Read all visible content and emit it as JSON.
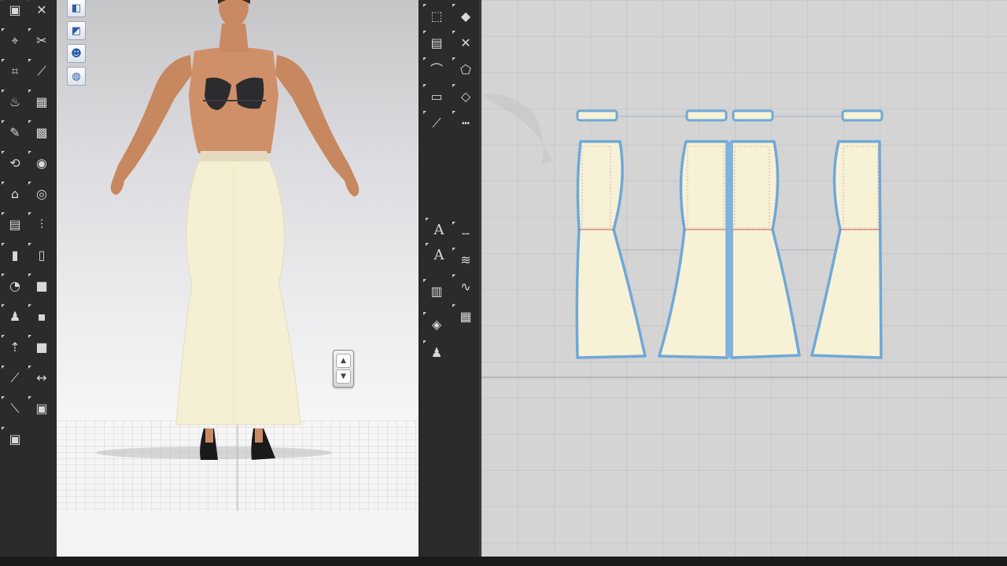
{
  "app": {
    "colors": {
      "toolbar_bg": "#2b2b2b",
      "fabric": "#f7f1d6",
      "pattern_outline": "#6fa8d6",
      "viewport_3d_bg": "#e6e6e9",
      "viewport_2d_bg": "#d4d4d4"
    }
  },
  "toolbar_left": {
    "tools": [
      {
        "icon": "select-mesh-icon",
        "glyph": "▣"
      },
      {
        "icon": "transform-icon",
        "glyph": "✕"
      },
      {
        "icon": "pin-icon",
        "glyph": "⌖"
      },
      {
        "icon": "scissors-icon",
        "glyph": "✂"
      },
      {
        "icon": "tack-icon",
        "glyph": "⌗"
      },
      {
        "icon": "fold-icon",
        "glyph": "⟋"
      },
      {
        "icon": "steam-icon",
        "glyph": "♨"
      },
      {
        "icon": "grid-icon",
        "glyph": "▦"
      },
      {
        "icon": "brush-icon",
        "glyph": "✎"
      },
      {
        "icon": "shirt-check-icon",
        "glyph": "▩"
      },
      {
        "icon": "flip-icon",
        "glyph": "⟲"
      },
      {
        "icon": "button-icon",
        "glyph": "◉"
      },
      {
        "icon": "hanger-icon",
        "glyph": "⌂"
      },
      {
        "icon": "buttonhole-icon",
        "glyph": "◎"
      },
      {
        "icon": "shirt-icon",
        "glyph": "▤"
      },
      {
        "icon": "zipper-icon",
        "glyph": "⫶"
      },
      {
        "icon": "tube-icon",
        "glyph": "▮"
      },
      {
        "icon": "strap-icon",
        "glyph": "▯"
      },
      {
        "icon": "puckering-icon",
        "glyph": "◔"
      },
      {
        "icon": "texture-icon",
        "glyph": "■"
      },
      {
        "icon": "avatar-icon",
        "glyph": "♟"
      },
      {
        "icon": "layer-icon",
        "glyph": "▪"
      },
      {
        "icon": "garment-up-icon",
        "glyph": "⇡"
      },
      {
        "icon": "fill-icon",
        "glyph": "■"
      },
      {
        "icon": "needle-icon",
        "glyph": "⟋"
      },
      {
        "icon": "arrows-icon",
        "glyph": "↔"
      },
      {
        "icon": "ruler-icon",
        "glyph": "⟍"
      },
      {
        "icon": "tshirt-icon",
        "glyph": "▣"
      },
      {
        "icon": "tshirt-alt-icon",
        "glyph": "▣"
      }
    ]
  },
  "toolbar_mid": {
    "tools": [
      {
        "icon": "select-pattern-icon",
        "glyph": "⬚"
      },
      {
        "icon": "edit-point-icon",
        "glyph": "◆"
      },
      {
        "icon": "shirt-pattern-icon",
        "glyph": "▤"
      },
      {
        "icon": "segment-icon",
        "glyph": "✕"
      },
      {
        "icon": "curve-icon",
        "glyph": "⌒"
      },
      {
        "icon": "polygon-icon",
        "glyph": "⬠"
      },
      {
        "icon": "rectangle-icon",
        "glyph": "▭"
      },
      {
        "icon": "dart-icon",
        "glyph": "◇"
      },
      {
        "icon": "sewing-icon",
        "glyph": "⟋"
      },
      {
        "icon": "seam-icon",
        "glyph": "┅"
      },
      {
        "icon": "internal-line-icon",
        "glyph": "╌"
      },
      {
        "icon": "zigzag-icon",
        "glyph": "≋"
      },
      {
        "icon": "wave-icon",
        "glyph": "∿"
      },
      {
        "icon": "hatch-icon",
        "glyph": "▥"
      },
      {
        "icon": "fold-arrange-icon",
        "glyph": "◈"
      },
      {
        "icon": "grid-pattern-icon",
        "glyph": "▦"
      },
      {
        "icon": "avatar-small-icon",
        "glyph": "♟"
      }
    ],
    "text_tools": [
      "A",
      "A"
    ]
  },
  "viewport_3d": {
    "view_buttons": [
      {
        "icon": "fabric-view-icon",
        "glyph": "◧"
      },
      {
        "icon": "mesh-view-icon",
        "glyph": "◩"
      },
      {
        "icon": "avatar-view-icon",
        "glyph": "☻"
      },
      {
        "icon": "globe-view-icon",
        "glyph": "◍"
      }
    ],
    "zoom_stepper": {
      "up": "▲",
      "down": "▼"
    }
  },
  "viewport_2d": {
    "patterns": [
      {
        "name": "pattern-front-left",
        "waistband": true
      },
      {
        "name": "pattern-front-center-left",
        "waistband": true
      },
      {
        "name": "pattern-front-center-right",
        "waistband": true
      },
      {
        "name": "pattern-back",
        "waistband": true
      }
    ]
  }
}
